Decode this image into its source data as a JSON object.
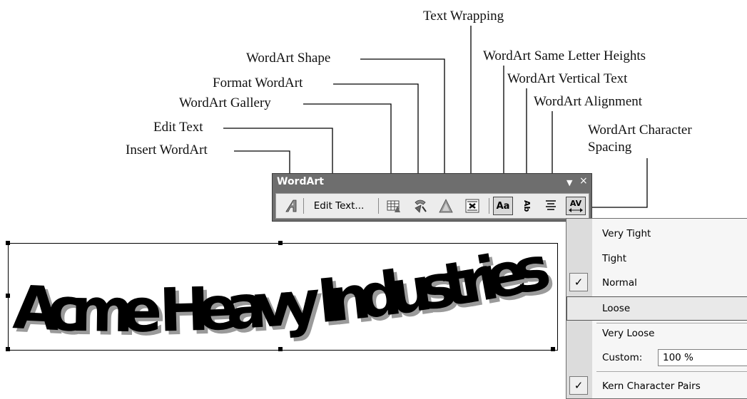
{
  "callouts": {
    "text_wrapping": "Text Wrapping",
    "wordart_shape": "WordArt Shape",
    "format_wordart": "Format WordArt",
    "wordart_gallery": "WordArt Gallery",
    "edit_text": "Edit Text",
    "insert_wordart": "Insert WordArt",
    "same_letter_heights": "WordArt Same Letter Heights",
    "vertical_text": "WordArt Vertical Text",
    "alignment": "WordArt Alignment",
    "char_spacing_line1": "WordArt Character",
    "char_spacing_line2": "Spacing"
  },
  "toolbar": {
    "title": "WordArt",
    "dropdown_glyph": "▼",
    "close_glyph": "×",
    "edit_text_label": "Edit Text...",
    "icons": [
      "insert-wordart-icon",
      "wordart-gallery-icon",
      "format-wordart-icon",
      "wordart-shape-icon",
      "text-wrapping-icon",
      "same-letter-heights-icon",
      "vertical-text-icon",
      "alignment-icon",
      "character-spacing-icon"
    ],
    "same_letter_heights_glyph": "Aa",
    "vertical_text_glyph": "Ab",
    "spacing_glyph": "AV"
  },
  "wordart": {
    "text": "Acme Heavy Industries"
  },
  "menu": {
    "items": [
      {
        "label": "Very Tight",
        "checked": false
      },
      {
        "label": "Tight",
        "checked": false
      },
      {
        "label": "Normal",
        "checked": true
      },
      {
        "label": "Loose",
        "checked": false,
        "highlighted": true
      },
      {
        "label": "Very Loose",
        "checked": false
      },
      {
        "label": "Custom:",
        "value": "100 %"
      },
      {
        "label": "Kern Character Pairs",
        "checked": true
      }
    ],
    "check_glyph": "✓"
  }
}
